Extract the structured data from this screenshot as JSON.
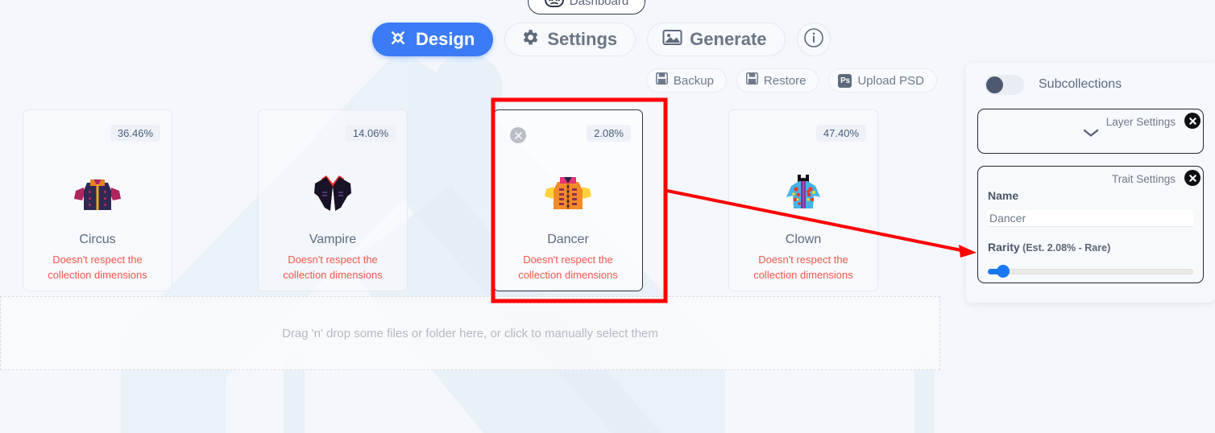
{
  "nav": {
    "dashboard_label": "Dashboard",
    "dashboard_icon": "dashboard-icon",
    "tabs": [
      {
        "label": "Design",
        "icon": "design-icon",
        "active": true
      },
      {
        "label": "Settings",
        "icon": "gear-icon",
        "active": false
      },
      {
        "label": "Generate",
        "icon": "image-icon",
        "active": false
      }
    ],
    "info_icon": "info-circle-icon"
  },
  "toolbar": {
    "backup_label": "Backup",
    "backup_icon": "save-icon",
    "restore_label": "Restore",
    "restore_icon": "save-icon",
    "upload_psd_label": "Upload PSD",
    "upload_psd_icon": "photoshop-icon",
    "ps_badge": "Ps"
  },
  "cards": [
    {
      "name": "Circus",
      "rarity_pct": "36.46%",
      "warning": "Doesn't respect the\ncollection dimensions",
      "thumb_icon": "circus-jacket-icon",
      "hovered": false,
      "show_close": false
    },
    {
      "name": "Vampire",
      "rarity_pct": "14.06%",
      "warning": "Doesn't respect the\ncollection dimensions",
      "thumb_icon": "vampire-cape-icon",
      "hovered": false,
      "show_close": false
    },
    {
      "name": "Dancer",
      "rarity_pct": "2.08%",
      "warning": "Doesn't respect the\ncollection dimensions",
      "thumb_icon": "dancer-jacket-icon",
      "hovered": true,
      "show_close": true
    },
    {
      "name": "Clown",
      "rarity_pct": "47.40%",
      "warning": "Doesn't respect the\ncollection dimensions",
      "thumb_icon": "clown-costume-icon",
      "hovered": false,
      "show_close": false
    }
  ],
  "dropzone": {
    "text": "Drag 'n' drop some files or folder here, or click to manually select them"
  },
  "right_panel": {
    "subcollections_label": "Subcollections",
    "subcollections_on": false,
    "layer_settings": {
      "title": "Layer Settings",
      "close_icon": "close-circle-icon",
      "chevron_icon": "chevron-down-icon"
    },
    "trait_settings": {
      "title": "Trait Settings",
      "close_icon": "close-circle-icon",
      "name_label": "Name",
      "name_value": "Dancer",
      "name_placeholder": "Name",
      "rarity_label": "Rarity",
      "rarity_detail": " (Est. 2.08% - Rare)",
      "rarity_slider_value": 4
    }
  },
  "annotation": {
    "highlight_color": "#ff0000",
    "arrow_color": "#ff0000"
  },
  "colors": {
    "accent_blue": "#3b7bf6",
    "warn_red": "#f3574b",
    "page_bg": "#f4f7fb",
    "slider_blue": "#1877f2"
  }
}
